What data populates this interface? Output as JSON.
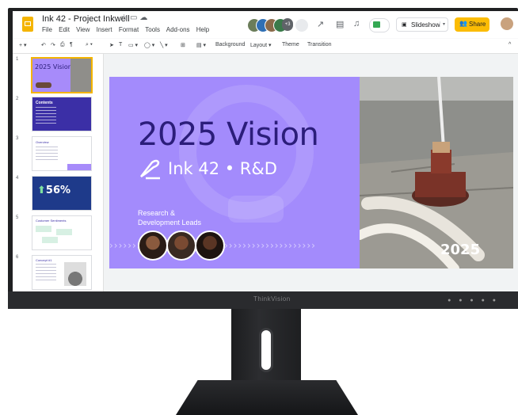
{
  "app": {
    "doc_title": "Ink 42 - Project Inkwell",
    "menu": [
      "File",
      "Edit",
      "View",
      "Insert",
      "Format",
      "Tools",
      "Add-ons",
      "Help"
    ],
    "collaborators_more": "+3",
    "slideshow_label": "Slideshow",
    "share_label": "Share"
  },
  "toolbar": {
    "background": "Background",
    "layout": "Layout",
    "theme": "Theme",
    "transition": "Transition"
  },
  "filmstrip": {
    "slides": [
      {
        "num": "1",
        "title": "2025 Vision",
        "style": "purple"
      },
      {
        "num": "2",
        "title": "Contents",
        "style": "dark"
      },
      {
        "num": "3",
        "title": "Overview",
        "style": "light"
      },
      {
        "num": "4",
        "title": "56%",
        "style": "blue"
      },
      {
        "num": "5",
        "title": "Customer Sentiments",
        "style": "light"
      },
      {
        "num": "6",
        "title": "Concept #1",
        "style": "light"
      }
    ]
  },
  "slide": {
    "title": "2025 Vision",
    "subtitle": "Ink 42 • R&D",
    "note_line1": "Research &",
    "note_line2": "Development Leads",
    "year": "2025",
    "chevrons": "›››››››››››››››››››››››››››››››››››››››››››››"
  },
  "monitor": {
    "brand": "ThinkVision"
  },
  "colors": {
    "accent_yellow": "#fbbc04",
    "slide_purple": "#a38bfc",
    "title_indigo": "#2b1d7a"
  }
}
